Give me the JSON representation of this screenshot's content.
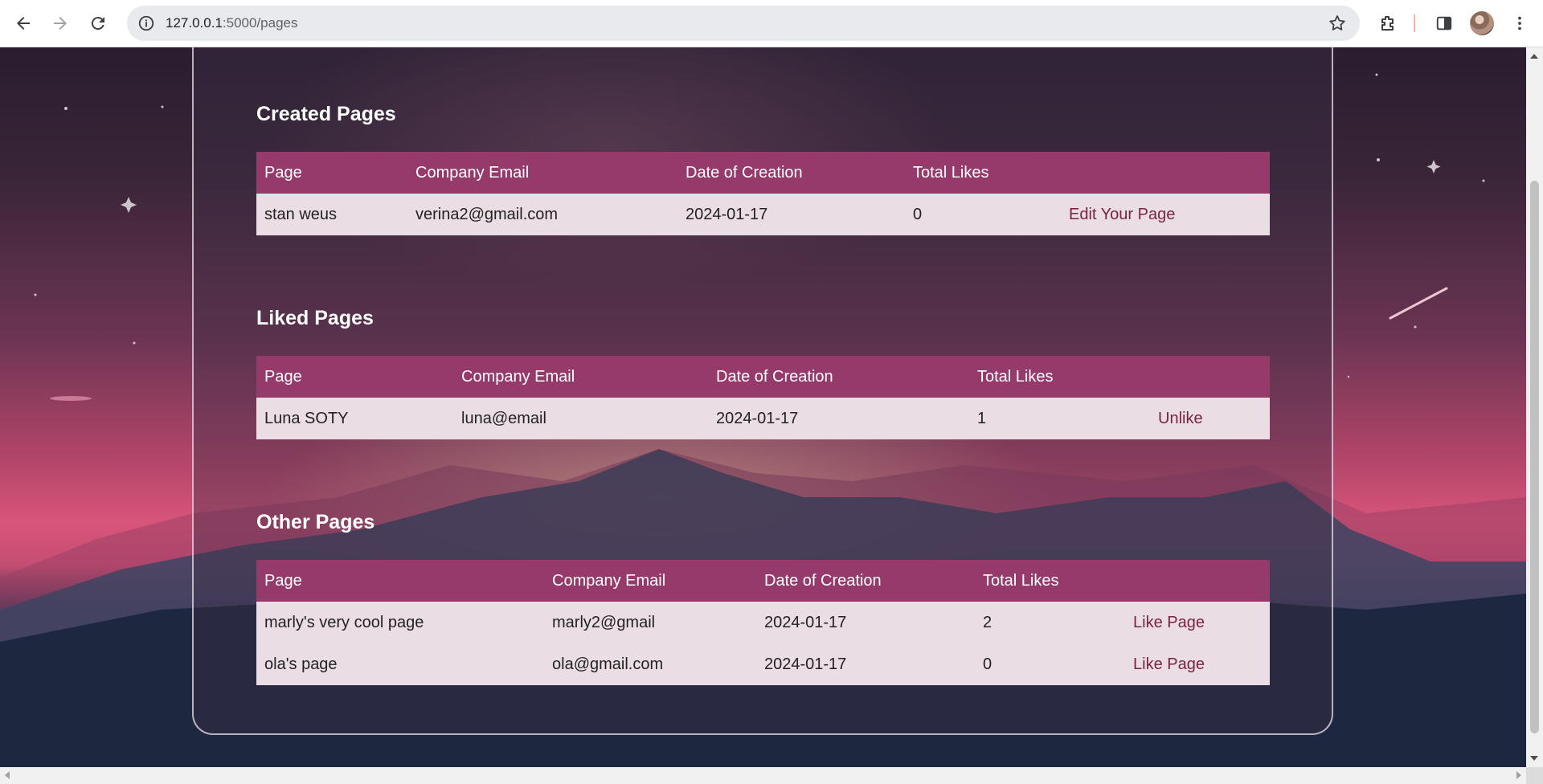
{
  "browser": {
    "url_host": "127.0.0.1",
    "url_path": ":5000/pages",
    "icons": [
      "back-arrow-icon",
      "forward-arrow-icon",
      "reload-icon",
      "site-info-icon",
      "bookmark-star-icon",
      "extensions-icon",
      "side-panel-icon",
      "more-menu-icon"
    ]
  },
  "sections": {
    "created": {
      "title": "Created Pages",
      "headers": [
        "Page",
        "Company Email",
        "Date of Creation",
        "Total Likes",
        ""
      ],
      "rows": [
        [
          "stan weus",
          "verina2@gmail.com",
          "2024-01-17",
          "0",
          "Edit Your Page"
        ]
      ]
    },
    "liked": {
      "title": "Liked Pages",
      "headers": [
        "Page",
        "Company Email",
        "Date of Creation",
        "Total Likes",
        ""
      ],
      "rows": [
        [
          "Luna SOTY",
          "luna@email",
          "2024-01-17",
          "1",
          "Unlike"
        ]
      ]
    },
    "other": {
      "title": "Other Pages",
      "headers": [
        "Page",
        "Company Email",
        "Date of Creation",
        "Total Likes",
        ""
      ],
      "rows": [
        [
          "marly's very cool page",
          "marly2@gmail",
          "2024-01-17",
          "2",
          "Like Page"
        ],
        [
          "ola's page",
          "ola@gmail.com",
          "2024-01-17",
          "0",
          "Like Page"
        ]
      ]
    }
  },
  "colors": {
    "table_header": "#953a6b",
    "table_row": "#eadde3",
    "action_link": "#7a2344"
  }
}
